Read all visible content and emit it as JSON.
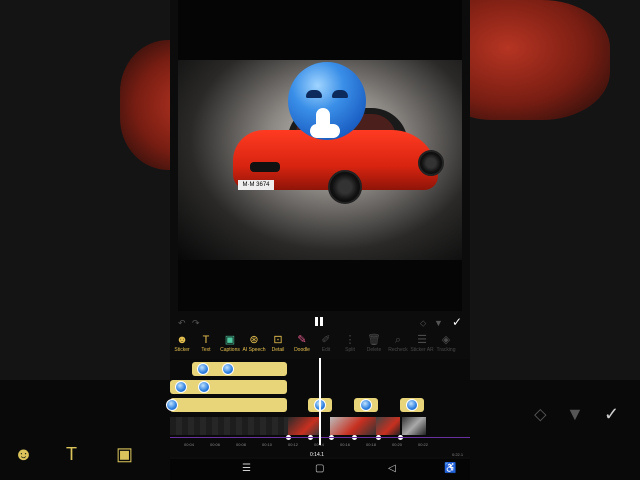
{
  "toolbar": {
    "items": [
      {
        "label": "Sticker",
        "icon": "sticker-icon",
        "state": "active"
      },
      {
        "label": "Text",
        "icon": "text-icon",
        "state": "active"
      },
      {
        "label": "Captions",
        "icon": "captions-icon",
        "state": "active"
      },
      {
        "label": "AI Speech",
        "icon": "ai-speech-icon",
        "state": "active"
      },
      {
        "label": "Detail",
        "icon": "detail-icon",
        "state": "active"
      },
      {
        "label": "Doodle",
        "icon": "doodle-icon",
        "state": "active"
      },
      {
        "label": "Edit",
        "icon": "edit-icon",
        "state": "dim"
      },
      {
        "label": "Split",
        "icon": "split-icon",
        "state": "dim"
      },
      {
        "label": "Delete",
        "icon": "delete-icon",
        "state": "dim"
      },
      {
        "label": "Recheck",
        "icon": "recheck-icon",
        "state": "dim"
      },
      {
        "label": "Sticker AR",
        "icon": "sticker-ar-icon",
        "state": "dim"
      },
      {
        "label": "Tracking",
        "icon": "tracking-icon",
        "state": "dim"
      }
    ]
  },
  "preview": {
    "plate_text": "M·M 3674"
  },
  "timeline": {
    "ruler_ticks": [
      "00:04",
      "00:06",
      "00:08",
      "00:10",
      "00:12",
      "00:14",
      "00:16",
      "00:18",
      "00:20",
      "00:22"
    ],
    "current_time": "0:14.1",
    "end_time": "0:22.1"
  },
  "colors": {
    "accent": "#e8d57a",
    "track_line": "#6a2fa0"
  }
}
